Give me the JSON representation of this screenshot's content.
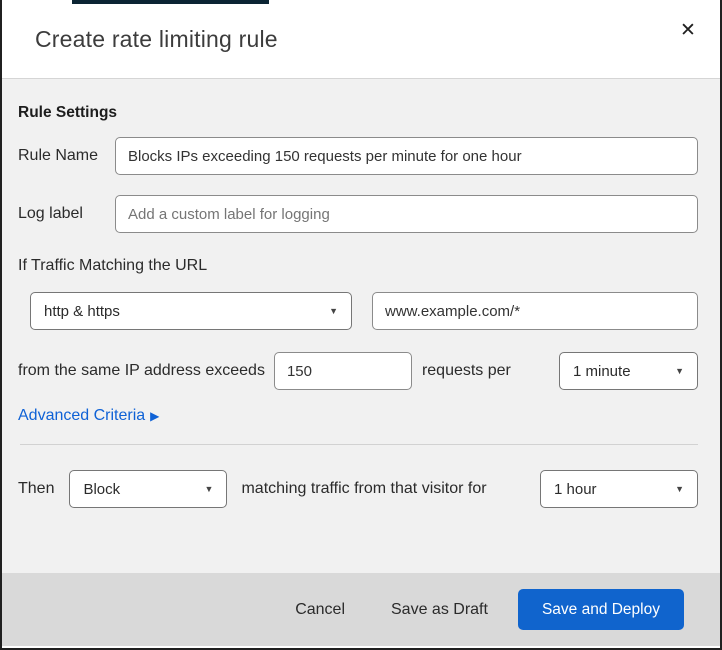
{
  "dialog": {
    "title": "Create rate limiting rule"
  },
  "icons": {
    "close": "✕",
    "caret_down": "▼",
    "arrow_right": "▶"
  },
  "rule_settings": {
    "heading": "Rule Settings",
    "rule_name": {
      "label": "Rule Name",
      "value": "Blocks IPs exceeding 150 requests per minute for one hour"
    },
    "log_label": {
      "label": "Log label",
      "placeholder": "Add a custom label for logging"
    }
  },
  "traffic_match": {
    "heading": "If Traffic Matching the URL",
    "scheme_selected": "http & https",
    "url_value": "www.example.com/*",
    "threshold_prefix": "from the same IP address exceeds",
    "threshold_value": "150",
    "threshold_suffix": "requests per",
    "period_selected": "1 minute",
    "advanced_link": "Advanced Criteria"
  },
  "action": {
    "then_label": "Then",
    "action_selected": "Block",
    "middle_text": "matching traffic from that visitor for",
    "duration_selected": "1 hour"
  },
  "footer": {
    "cancel": "Cancel",
    "save_draft": "Save as Draft",
    "save_deploy": "Save and Deploy"
  },
  "colors": {
    "accent_blue": "#0f62d6",
    "primary_button_blue": "#1064cd",
    "content_background": "#f1f1f1",
    "footer_background": "#d9d9d9"
  }
}
